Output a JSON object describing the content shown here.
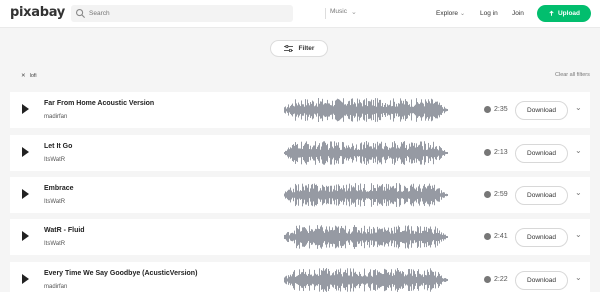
{
  "header": {
    "logo": "pixabay",
    "search_placeholder": "Search",
    "search_category": "Music",
    "explore": "Explore",
    "login": "Log in",
    "join": "Join",
    "upload": "Upload"
  },
  "filter_label": "Filter",
  "active_filter": "lofi",
  "clear_filters": "Clear all filters",
  "colors": {
    "accent": "#02be6e",
    "waveform": "#8a8f99"
  },
  "tracks": [
    {
      "title": "Far From Home Acoustic Version",
      "artist": "madirfan",
      "duration": "2:35",
      "download": "Download"
    },
    {
      "title": "Let It Go",
      "artist": "ItsWatR",
      "duration": "2:13",
      "download": "Download"
    },
    {
      "title": "Embrace",
      "artist": "ItsWatR",
      "duration": "2:59",
      "download": "Download"
    },
    {
      "title": "WatR - Fluid",
      "artist": "ItsWatR",
      "duration": "2:41",
      "download": "Download"
    },
    {
      "title": "Every Time We Say Goodbye (AcusticVersion)",
      "artist": "madirfan",
      "duration": "2:22",
      "download": "Download"
    }
  ]
}
